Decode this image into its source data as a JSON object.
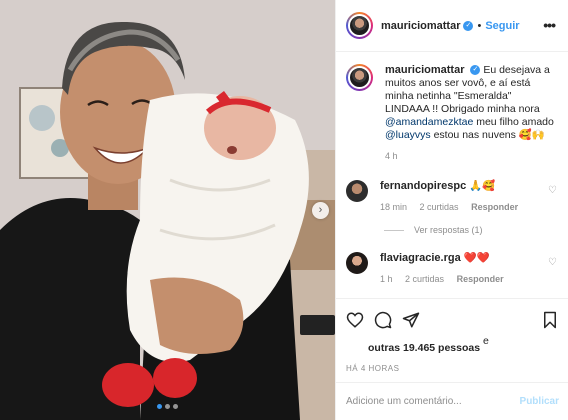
{
  "post": {
    "author": "mauriciomattar",
    "verified_icon": "verified-badge-icon",
    "separator": "•",
    "follow_label": "Seguir",
    "more_icon": "more-options-icon",
    "more_label": "•••",
    "caption_parts": [
      "Eu desejava a muitos anos ser vovô, e aí está minha netinha \"Esmeralda\" LINDAAA !! Obrigado minha nora ",
      "@amandamezktae",
      " meu filho amado ",
      "@luayvys",
      " estou nas nuvens 🥰🙌"
    ],
    "caption_time": "4 h"
  },
  "comments": [
    {
      "username": "fernandopirespc",
      "text": "🙏🥰",
      "time": "18 min",
      "likes": "2 curtidas",
      "reply_label": "Responder",
      "view_replies": "Ver respostas (1)"
    },
    {
      "username": "flaviagracie.rga",
      "text": "❤️❤️",
      "time": "1 h",
      "likes": "2 curtidas",
      "reply_label": "Responder"
    }
  ],
  "actions": {
    "like_icon": "heart-icon",
    "comment_icon": "comment-icon",
    "share_icon": "share-icon",
    "save_icon": "bookmark-icon",
    "likes_prefix": "e",
    "likes_text": "outras 19.465 pessoas",
    "time_ago": "HÁ 4 HORAS"
  },
  "comment_box": {
    "placeholder": "Adicione um comentário...",
    "publish_label": "Publicar"
  },
  "carousel": {
    "next_label": "›",
    "dot_count": 3,
    "active_dot": 1
  },
  "colors": {
    "accent": "#3897f0",
    "text": "#262626",
    "muted": "#8e8e8e",
    "border": "#efefef",
    "publish_disabled": "#b2dffc"
  }
}
